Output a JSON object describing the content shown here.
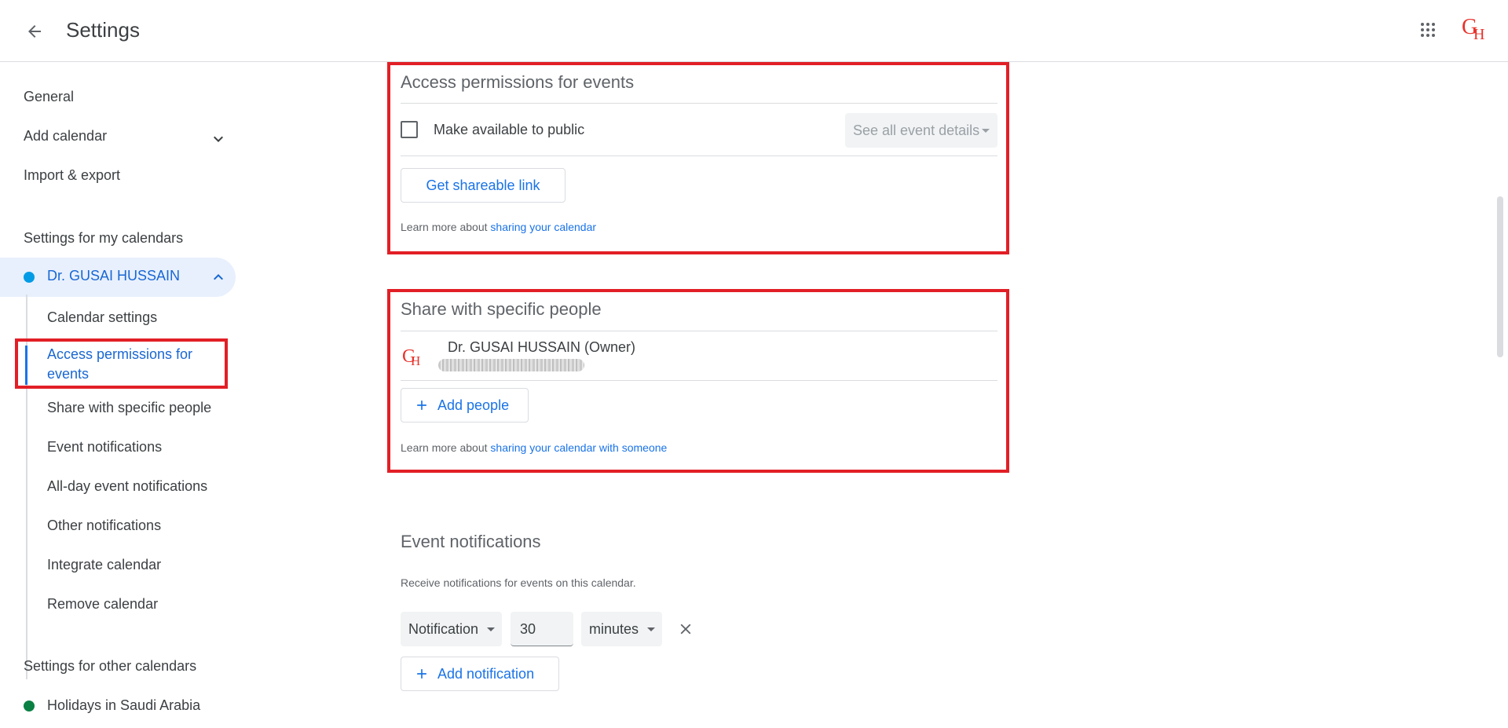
{
  "header": {
    "title": "Settings",
    "avatar_initials": {
      "g": "G",
      "h": "H"
    }
  },
  "sidebar": {
    "general": "General",
    "add_calendar": "Add calendar",
    "import_export": "Import & export",
    "my_calendars_heading": "Settings for my calendars",
    "calendar_name": "Dr. GUSAI HUSSAIN",
    "calendar_color": "#039be5",
    "sub_items": [
      "Calendar settings",
      "Access permissions for events",
      "Share with specific people",
      "Event notifications",
      "All-day event notifications",
      "Other notifications",
      "Integrate calendar",
      "Remove calendar"
    ],
    "active_sub_line1": "Access permissions for",
    "active_sub_line2": "events",
    "other_calendars_heading": "Settings for other calendars",
    "other_calendar": "Holidays in Saudi Arabia",
    "other_calendar_color": "#0b8043"
  },
  "access": {
    "title": "Access permissions for events",
    "public_label": "Make available to public",
    "public_select": "See all event details",
    "shareable_link": "Get shareable link",
    "learn_prefix": "Learn more about ",
    "learn_link": "sharing your calendar"
  },
  "share": {
    "title": "Share with specific people",
    "owner": "Dr. GUSAI HUSSAIN (Owner)",
    "add_people": "Add people",
    "learn_prefix": "Learn more about ",
    "learn_link": "sharing your calendar with someone"
  },
  "notifications": {
    "title": "Event notifications",
    "description": "Receive notifications for events on this calendar.",
    "type": "Notification",
    "amount": "30",
    "unit": "minutes",
    "add_notification": "Add notification"
  },
  "colors": {
    "accent": "#1a73e8",
    "highlight": "#e21f26",
    "selected_bg": "#e8f0fe"
  }
}
